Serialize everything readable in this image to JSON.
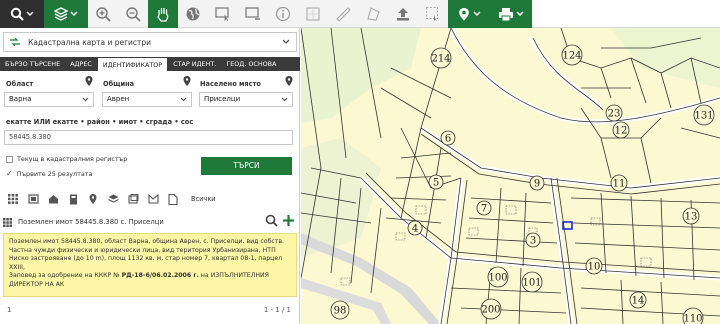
{
  "toolbar": {
    "buttons": [
      "search-tool",
      "layers-tool",
      "zoom-in-tool",
      "zoom-out-tool",
      "pan-tool",
      "globe-tool",
      "select-rect-tool",
      "select-tool",
      "info-tool",
      "measure-area-tool",
      "measure-line-tool",
      "measure-polygon-tool",
      "upload-tool",
      "select-features-tool",
      "location-tool",
      "print-tool"
    ]
  },
  "panel": {
    "layer_select": "Кадастрална карта и регистри",
    "tabs": [
      "БЪРЗО ТЪРСЕНЕ",
      "АДРЕС",
      "ИДЕНТИФИКАТОР",
      "СТАР ИДЕНТ.",
      "ГЕОД. ОСНОВА"
    ],
    "active_tab": 2,
    "fields": {
      "oblast_label": "Област",
      "oblast_value": "Варна",
      "obshtina_label": "Община",
      "obshtina_value": "Аврен",
      "naseleno_label": "Населено място",
      "naseleno_value": "Приселци",
      "ident_label": "екатте ИЛИ екатте • район • имот • сграда • сос",
      "ident_value": "58445.8.380"
    },
    "checkbox1": "Текущ в кадастралния регистър",
    "checkbox2": "Първите 25 резултата",
    "search_button": "ТЪРСИ",
    "icons_all": "Всички",
    "result_title": "Поземлен имот 58445.8.380 с. Приселци",
    "result_body_1": "Поземлен имот 58445.8.380, област Варна, община Аврен, с. Приселци, вид собств.",
    "result_body_2": "Частна чужди физически и юридически лица, вид територия Урбанизирана, НТП",
    "result_body_3": "Ниско застрояване (до 10 m), площ 1132 кв. м, стар номер 7, квартал 08-1, парцел",
    "result_body_4": "XXIII,",
    "result_body_5a": "Заповед за одобрение на КККР №",
    "result_body_5b": "РД-18-6/06.02.2006 г.",
    "result_body_5c": "на ИЗПЪЛНИТЕЛНИЯ",
    "result_body_6": "ДИРЕКТОР НА АК",
    "pager_left": "1",
    "pager_right": "1 - 1 / 1"
  },
  "map": {
    "parcel_labels": [
      "214",
      "124",
      "23",
      "12",
      "131",
      "6",
      "5",
      "9",
      "11",
      "7",
      "4",
      "13",
      "3",
      "10",
      "100",
      "101",
      "200",
      "14",
      "98",
      "110"
    ]
  }
}
